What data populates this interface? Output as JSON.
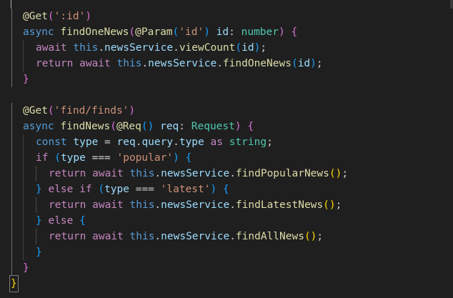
{
  "editor": {
    "lines": [
      [
        {
          "t": "@Get",
          "c": "t-fn"
        },
        {
          "t": "(",
          "c": "t-br2"
        },
        {
          "t": "':id'",
          "c": "t-str"
        },
        {
          "t": ")",
          "c": "t-br2"
        }
      ],
      [
        {
          "t": "async ",
          "c": "t-kw"
        },
        {
          "t": "findOneNews",
          "c": "t-fn"
        },
        {
          "t": "(",
          "c": "t-br2"
        },
        {
          "t": "@Param",
          "c": "t-fn"
        },
        {
          "t": "(",
          "c": "t-br3"
        },
        {
          "t": "'id'",
          "c": "t-str"
        },
        {
          "t": ")",
          "c": "t-br3"
        },
        {
          "t": " ",
          "c": "t-pl"
        },
        {
          "t": "id",
          "c": "t-var"
        },
        {
          "t": ": ",
          "c": "t-pl"
        },
        {
          "t": "number",
          "c": "t-typ"
        },
        {
          "t": ")",
          "c": "t-br2"
        },
        {
          "t": " ",
          "c": "t-pl"
        },
        {
          "t": "{",
          "c": "t-br2"
        }
      ],
      [
        {
          "t": "await ",
          "c": "t-ctl"
        },
        {
          "t": "this",
          "c": "t-kw"
        },
        {
          "t": ".",
          "c": "t-pl"
        },
        {
          "t": "newsService",
          "c": "t-var"
        },
        {
          "t": ".",
          "c": "t-pl"
        },
        {
          "t": "viewCount",
          "c": "t-fn"
        },
        {
          "t": "(",
          "c": "t-br3"
        },
        {
          "t": "id",
          "c": "t-var"
        },
        {
          "t": ")",
          "c": "t-br3"
        },
        {
          "t": ";",
          "c": "t-pl"
        }
      ],
      [
        {
          "t": "return ",
          "c": "t-ctl"
        },
        {
          "t": "await ",
          "c": "t-ctl"
        },
        {
          "t": "this",
          "c": "t-kw"
        },
        {
          "t": ".",
          "c": "t-pl"
        },
        {
          "t": "newsService",
          "c": "t-var"
        },
        {
          "t": ".",
          "c": "t-pl"
        },
        {
          "t": "findOneNews",
          "c": "t-fn"
        },
        {
          "t": "(",
          "c": "t-br3"
        },
        {
          "t": "id",
          "c": "t-var"
        },
        {
          "t": ")",
          "c": "t-br3"
        },
        {
          "t": ";",
          "c": "t-pl"
        }
      ],
      [
        {
          "t": "}",
          "c": "t-br2"
        }
      ],
      [],
      [
        {
          "t": "@Get",
          "c": "t-fn"
        },
        {
          "t": "(",
          "c": "t-br2"
        },
        {
          "t": "'find/finds'",
          "c": "t-str"
        },
        {
          "t": ")",
          "c": "t-br2"
        }
      ],
      [
        {
          "t": "async ",
          "c": "t-kw"
        },
        {
          "t": "findNews",
          "c": "t-fn"
        },
        {
          "t": "(",
          "c": "t-br2"
        },
        {
          "t": "@Req",
          "c": "t-fn"
        },
        {
          "t": "()",
          "c": "t-br3"
        },
        {
          "t": " ",
          "c": "t-pl"
        },
        {
          "t": "req",
          "c": "t-var"
        },
        {
          "t": ": ",
          "c": "t-pl"
        },
        {
          "t": "Request",
          "c": "t-typ"
        },
        {
          "t": ")",
          "c": "t-br2"
        },
        {
          "t": " ",
          "c": "t-pl"
        },
        {
          "t": "{",
          "c": "t-br2"
        }
      ],
      [
        {
          "t": "const ",
          "c": "t-kw"
        },
        {
          "t": "type",
          "c": "t-var"
        },
        {
          "t": " = ",
          "c": "t-pl"
        },
        {
          "t": "req",
          "c": "t-var"
        },
        {
          "t": ".",
          "c": "t-pl"
        },
        {
          "t": "query",
          "c": "t-var"
        },
        {
          "t": ".",
          "c": "t-pl"
        },
        {
          "t": "type",
          "c": "t-var"
        },
        {
          "t": " ",
          "c": "t-pl"
        },
        {
          "t": "as ",
          "c": "t-ctl"
        },
        {
          "t": "string",
          "c": "t-typ"
        },
        {
          "t": ";",
          "c": "t-pl"
        }
      ],
      [
        {
          "t": "if ",
          "c": "t-ctl"
        },
        {
          "t": "(",
          "c": "t-br3"
        },
        {
          "t": "type",
          "c": "t-var"
        },
        {
          "t": " === ",
          "c": "t-pl"
        },
        {
          "t": "'popular'",
          "c": "t-str"
        },
        {
          "t": ")",
          "c": "t-br3"
        },
        {
          "t": " ",
          "c": "t-pl"
        },
        {
          "t": "{",
          "c": "t-br3"
        }
      ],
      [
        {
          "t": "return ",
          "c": "t-ctl"
        },
        {
          "t": "await ",
          "c": "t-ctl"
        },
        {
          "t": "this",
          "c": "t-kw"
        },
        {
          "t": ".",
          "c": "t-pl"
        },
        {
          "t": "newsService",
          "c": "t-var"
        },
        {
          "t": ".",
          "c": "t-pl"
        },
        {
          "t": "findPopularNews",
          "c": "t-fn"
        },
        {
          "t": "()",
          "c": "t-br1"
        },
        {
          "t": ";",
          "c": "t-pl"
        }
      ],
      [
        {
          "t": "} ",
          "c": "t-br3"
        },
        {
          "t": "else ",
          "c": "t-ctl"
        },
        {
          "t": "if ",
          "c": "t-ctl"
        },
        {
          "t": "(",
          "c": "t-br3"
        },
        {
          "t": "type",
          "c": "t-var"
        },
        {
          "t": " === ",
          "c": "t-pl"
        },
        {
          "t": "'latest'",
          "c": "t-str"
        },
        {
          "t": ")",
          "c": "t-br3"
        },
        {
          "t": " ",
          "c": "t-pl"
        },
        {
          "t": "{",
          "c": "t-br3"
        }
      ],
      [
        {
          "t": "return ",
          "c": "t-ctl"
        },
        {
          "t": "await ",
          "c": "t-ctl"
        },
        {
          "t": "this",
          "c": "t-kw"
        },
        {
          "t": ".",
          "c": "t-pl"
        },
        {
          "t": "newsService",
          "c": "t-var"
        },
        {
          "t": ".",
          "c": "t-pl"
        },
        {
          "t": "findLatestNews",
          "c": "t-fn"
        },
        {
          "t": "()",
          "c": "t-br1"
        },
        {
          "t": ";",
          "c": "t-pl"
        }
      ],
      [
        {
          "t": "} ",
          "c": "t-br3"
        },
        {
          "t": "else ",
          "c": "t-ctl"
        },
        {
          "t": "{",
          "c": "t-br3"
        }
      ],
      [
        {
          "t": "return ",
          "c": "t-ctl"
        },
        {
          "t": "await ",
          "c": "t-ctl"
        },
        {
          "t": "this",
          "c": "t-kw"
        },
        {
          "t": ".",
          "c": "t-pl"
        },
        {
          "t": "newsService",
          "c": "t-var"
        },
        {
          "t": ".",
          "c": "t-pl"
        },
        {
          "t": "findAllNews",
          "c": "t-fn"
        },
        {
          "t": "()",
          "c": "t-br1"
        },
        {
          "t": ";",
          "c": "t-pl"
        }
      ],
      [
        {
          "t": "}",
          "c": "t-br3"
        }
      ],
      [
        {
          "t": "}",
          "c": "t-br2"
        }
      ]
    ],
    "closing_brace": "}",
    "colors": {
      "background": "#1f1f1f",
      "keyword": "#569cd6",
      "control": "#c586c0",
      "function": "#dcdcaa",
      "variable": "#9cdcfe",
      "string": "#ce9178",
      "type": "#4ec9b0",
      "bracket_1": "#ffd700",
      "bracket_2": "#da70d6",
      "bracket_3": "#179fff"
    }
  }
}
